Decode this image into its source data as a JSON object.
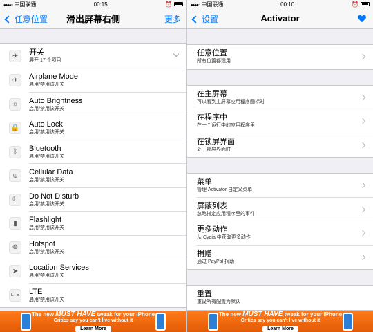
{
  "left": {
    "status": {
      "carrier": "中国联通",
      "time": "00:15"
    },
    "nav": {
      "back": "任意位置",
      "title": "滑出屏幕右侧",
      "right": "更多"
    },
    "header_row": {
      "title": "开关",
      "subtitle": "展开 17 个项目",
      "icon": "airplane-icon"
    },
    "items": [
      {
        "title": "Airplane Mode",
        "subtitle": "启用/禁用该开关",
        "icon": "✈"
      },
      {
        "title": "Auto Brightness",
        "subtitle": "启用/禁用该开关",
        "icon": "☼"
      },
      {
        "title": "Auto Lock",
        "subtitle": "启用/禁用该开关",
        "icon": "🔒"
      },
      {
        "title": "Bluetooth",
        "subtitle": "启用/禁用该开关",
        "icon": "ᛒ"
      },
      {
        "title": "Cellular Data",
        "subtitle": "启用/禁用该开关",
        "icon": "⍦"
      },
      {
        "title": "Do Not Disturb",
        "subtitle": "启用/禁用该开关",
        "icon": "☾"
      },
      {
        "title": "Flashlight",
        "subtitle": "启用/禁用该开关",
        "icon": "▮"
      },
      {
        "title": "Hotspot",
        "subtitle": "启用/禁用该开关",
        "icon": "⊚"
      },
      {
        "title": "Location Services",
        "subtitle": "启用/禁用该开关",
        "icon": "➤"
      },
      {
        "title": "LTE",
        "subtitle": "启用/禁用该开关",
        "icon": "LTE"
      }
    ]
  },
  "right": {
    "status": {
      "carrier": "中国联通",
      "time": "00:10"
    },
    "nav": {
      "back": "设置",
      "title": "Activator"
    },
    "group1": [
      {
        "title": "任意位置",
        "subtitle": "所有位置都适用"
      }
    ],
    "group2": [
      {
        "title": "在主屏幕",
        "subtitle": "可以看到主屏幕应用程序图标时"
      },
      {
        "title": "在程序中",
        "subtitle": "在一个运行中的应用程序里"
      },
      {
        "title": "在锁屏界面",
        "subtitle": "处于锁屏界面时"
      }
    ],
    "group3": [
      {
        "title": "菜单",
        "subtitle": "管理 Activator 自定义菜单"
      },
      {
        "title": "屏蔽列表",
        "subtitle": "忽略指定应用程序里的事件"
      },
      {
        "title": "更多动作",
        "subtitle": "从 Cydia 中获取更多动作"
      },
      {
        "title": "捐赠",
        "subtitle": "通过 PayPal 捐助"
      }
    ],
    "group4": [
      {
        "title": "重置",
        "subtitle": "重设所有配置为默认"
      }
    ]
  },
  "ad": {
    "line1_pre": "The new ",
    "line1_must": "MUST HAVE",
    "line1_post": " tweak for your iPhone",
    "line2": "Critics say you can't live without it",
    "button": "Learn More"
  },
  "colors": {
    "accent": "#007aff",
    "ad": "#f26a10"
  }
}
